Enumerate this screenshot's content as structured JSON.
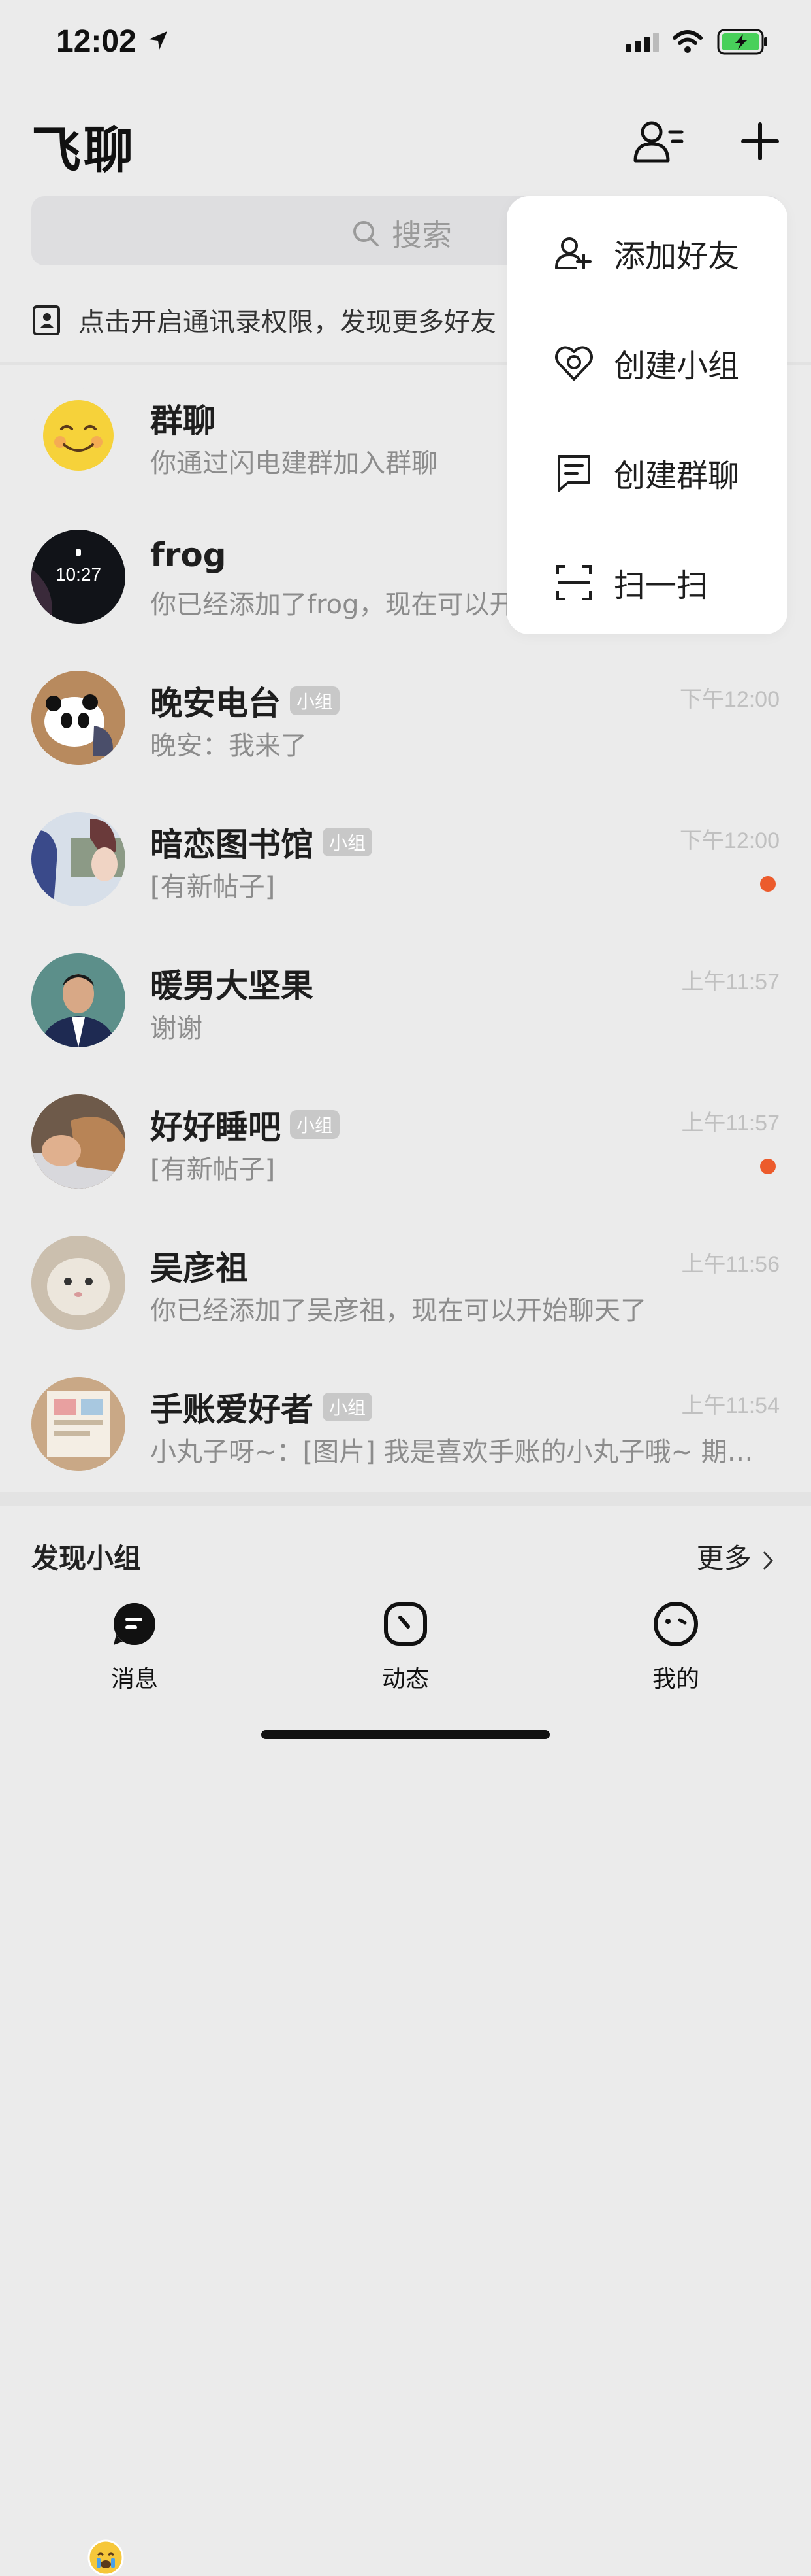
{
  "status_bar": {
    "time": "12:02"
  },
  "header": {
    "title": "飞聊"
  },
  "search": {
    "placeholder": "搜索"
  },
  "contacts_tip": "点击开启通讯录权限，发现更多好友",
  "chats": [
    {
      "name": "群聊",
      "tag": "",
      "subtitle": "你通过闪电建群加入群聊",
      "time": "",
      "unread": false,
      "avatar": "smiley"
    },
    {
      "name": "frog",
      "tag": "",
      "subtitle": "你已经添加了frog，现在可以开始聊天了",
      "time": "",
      "unread": false,
      "avatar": "watch"
    },
    {
      "name": "晚安电台",
      "tag": "小组",
      "subtitle": "晚安：我来了",
      "time": "下午12:00",
      "unread": false,
      "avatar": "panda"
    },
    {
      "name": "暗恋图书馆",
      "tag": "小组",
      "subtitle": "[有新帖子]",
      "time": "下午12:00",
      "unread": true,
      "avatar": "anime"
    },
    {
      "name": "暖男大坚果",
      "tag": "",
      "subtitle": "谢谢",
      "time": "上午11:57",
      "unread": false,
      "avatar": "man"
    },
    {
      "name": "好好睡吧",
      "tag": "小组",
      "subtitle": "[有新帖子]",
      "time": "上午11:57",
      "unread": true,
      "avatar": "sleep"
    },
    {
      "name": "吴彦祖",
      "tag": "",
      "subtitle": "你已经添加了吴彦祖，现在可以开始聊天了",
      "time": "上午11:56",
      "unread": false,
      "avatar": "cat"
    },
    {
      "name": "手账爱好者",
      "tag": "小组",
      "subtitle": "小丸子呀~：[图片] 我是喜欢手账的小丸子哦~ 期…",
      "time": "上午11:54",
      "unread": false,
      "avatar": "journal"
    }
  ],
  "discover": {
    "title": "发现小组",
    "more": "更多"
  },
  "tabs": [
    {
      "label": "消息",
      "icon": "message-icon"
    },
    {
      "label": "动态",
      "icon": "moments-icon"
    },
    {
      "label": "我的",
      "icon": "profile-icon"
    }
  ],
  "menu": {
    "items": [
      {
        "label": "添加好友",
        "icon": "add-friend-icon"
      },
      {
        "label": "创建小组",
        "icon": "create-group-icon"
      },
      {
        "label": "创建群聊",
        "icon": "create-chat-icon"
      },
      {
        "label": "扫一扫",
        "icon": "scan-icon"
      }
    ]
  }
}
